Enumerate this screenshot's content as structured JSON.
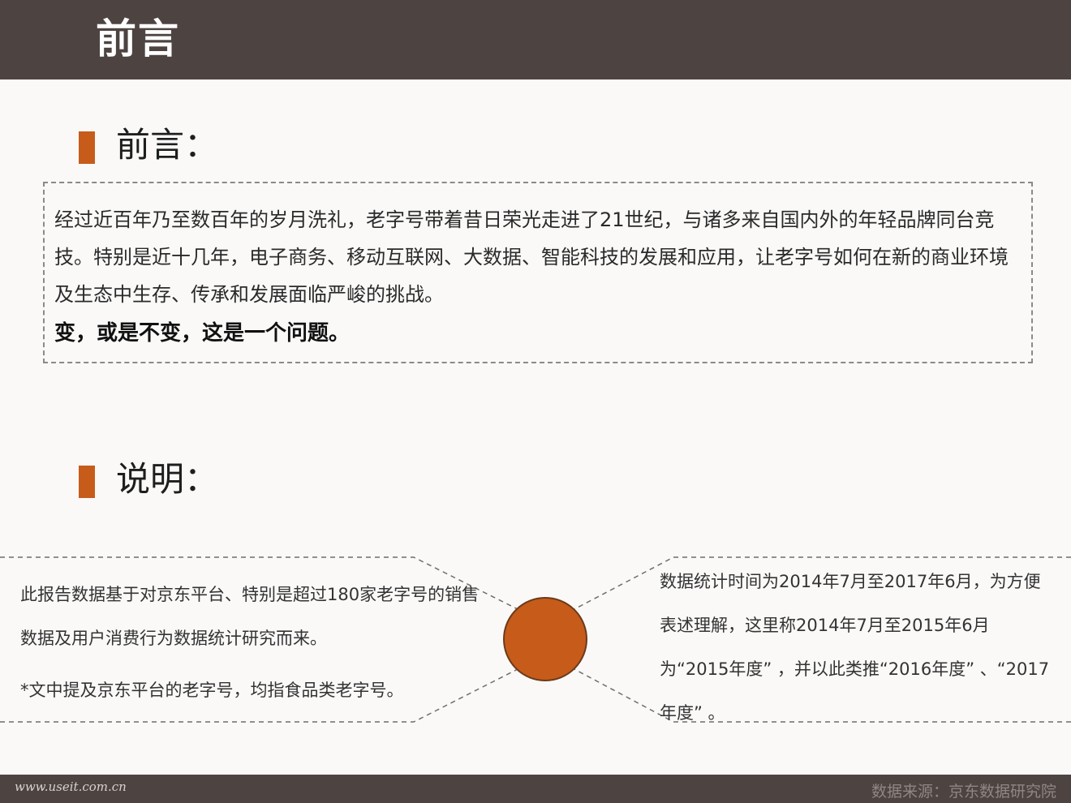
{
  "header": {
    "title": "前言"
  },
  "preface": {
    "heading": "前言：",
    "paragraph": "经过近百年乃至数百年的岁月洗礼，老字号带着昔日荣光走进了21世纪，与诸多来自国内外的年轻品牌同台竞技。特别是近十几年，电子商务、移动互联网、大数据、智能科技的发展和应用，让老字号如何在新的商业环境及生态中生存、传承和发展面临严峻的挑战。",
    "question": "变，或是不变，这是一个问题。"
  },
  "explanation": {
    "heading": "说明：",
    "left_line1": "此报告数据基于对京东平台、特别是超过180家老字号的销售数据及用户消费行为数据统计研究而来。",
    "left_footnote": "*文中提及京东平台的老字号，均指食品类老字号。",
    "right_text": "数据统计时间为2014年7月至2017年6月，为方便表述理解，这里称2014年7月至2015年6月为“2015年度” ，并以此类推“2016年度” 、“2017年度” 。"
  },
  "footer": {
    "site": "www.useit.com.cn",
    "source": "数据来源：京东数据研究院"
  },
  "colors": {
    "bar": "#4d4442",
    "accent": "#c75b1a"
  }
}
